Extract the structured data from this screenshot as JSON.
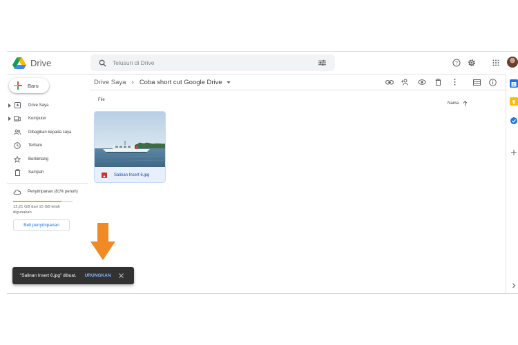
{
  "app": {
    "name": "Drive"
  },
  "header": {
    "search_placeholder": "Telusuri di Drive",
    "icons": [
      "search-icon",
      "tune-icon",
      "help-icon",
      "settings-icon",
      "apps-icon",
      "avatar"
    ]
  },
  "sidebar": {
    "new_label": "Baru",
    "items": [
      {
        "label": "Drive Saya",
        "icon": "my-drive-icon",
        "expandable": true
      },
      {
        "label": "Komputer",
        "icon": "computer-icon",
        "expandable": true
      },
      {
        "label": "Dibagikan kepada saya",
        "icon": "shared-icon",
        "expandable": false
      },
      {
        "label": "Terbaru",
        "icon": "clock-icon",
        "expandable": false
      },
      {
        "label": "Berbintang",
        "icon": "star-icon",
        "expandable": false
      },
      {
        "label": "Sampah",
        "icon": "trash-icon",
        "expandable": false
      }
    ],
    "storage": {
      "label": "Penyimpanan (81% penuh)",
      "used_fraction": 0.81,
      "detail": "12,21 GB dari 15 GB telah digunakan",
      "buy_label": "Beli penyimpanan"
    }
  },
  "breadcrumb": {
    "root": "Drive Saya",
    "separator": "›",
    "current": "Coba short cut Google Drive"
  },
  "toolbar": {
    "icons": [
      "link-icon",
      "add-person-icon",
      "preview-icon",
      "delete-icon",
      "more-icon",
      "list-view-icon",
      "info-icon"
    ]
  },
  "content": {
    "section_label": "File",
    "sort_label": "Nama",
    "sort_direction": "ascending",
    "files": [
      {
        "name": "Salinan Insert 6.jpg",
        "type": "image"
      }
    ]
  },
  "snackbar": {
    "message": "\"Salinan Insert 6.jpg\" dibuat.",
    "action": "URUNGKAN"
  },
  "colors": {
    "accent": "#1a73e8",
    "storage_bar": "#f9ab00",
    "selected_card": "#e8f0fe",
    "snackbar_bg": "#323232",
    "snackbar_action": "#8ab4f8",
    "arrow": "#f08a24"
  }
}
